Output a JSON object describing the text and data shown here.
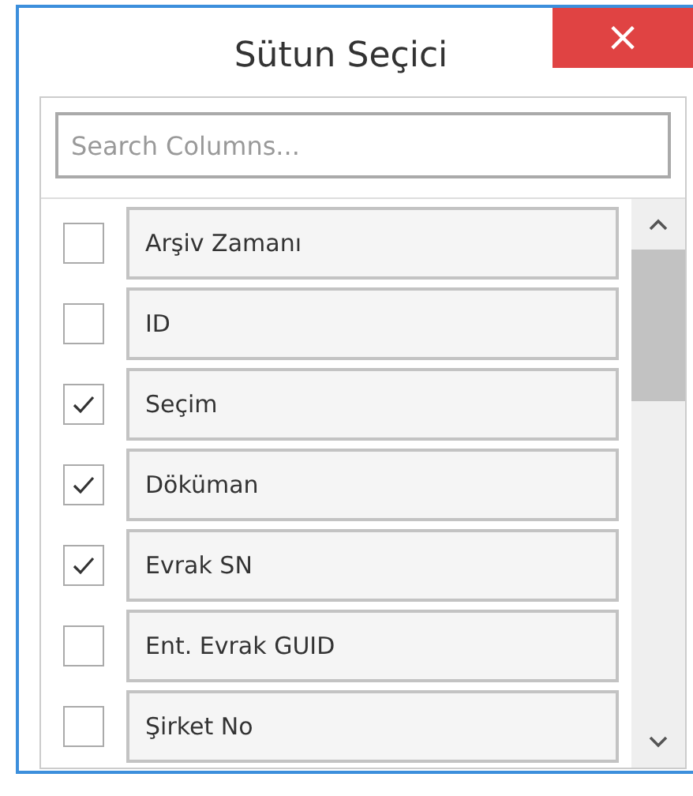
{
  "window": {
    "title": "Sütun Seçici",
    "close_label": "×"
  },
  "search": {
    "placeholder": "Search Columns..."
  },
  "columns": [
    {
      "label": "Arşiv Zamanı",
      "checked": false
    },
    {
      "label": "ID",
      "checked": false
    },
    {
      "label": "Seçim",
      "checked": true
    },
    {
      "label": "Döküman",
      "checked": true
    },
    {
      "label": "Evrak SN",
      "checked": true
    },
    {
      "label": "Ent. Evrak GUID",
      "checked": false
    },
    {
      "label": "Şirket No",
      "checked": false
    }
  ]
}
